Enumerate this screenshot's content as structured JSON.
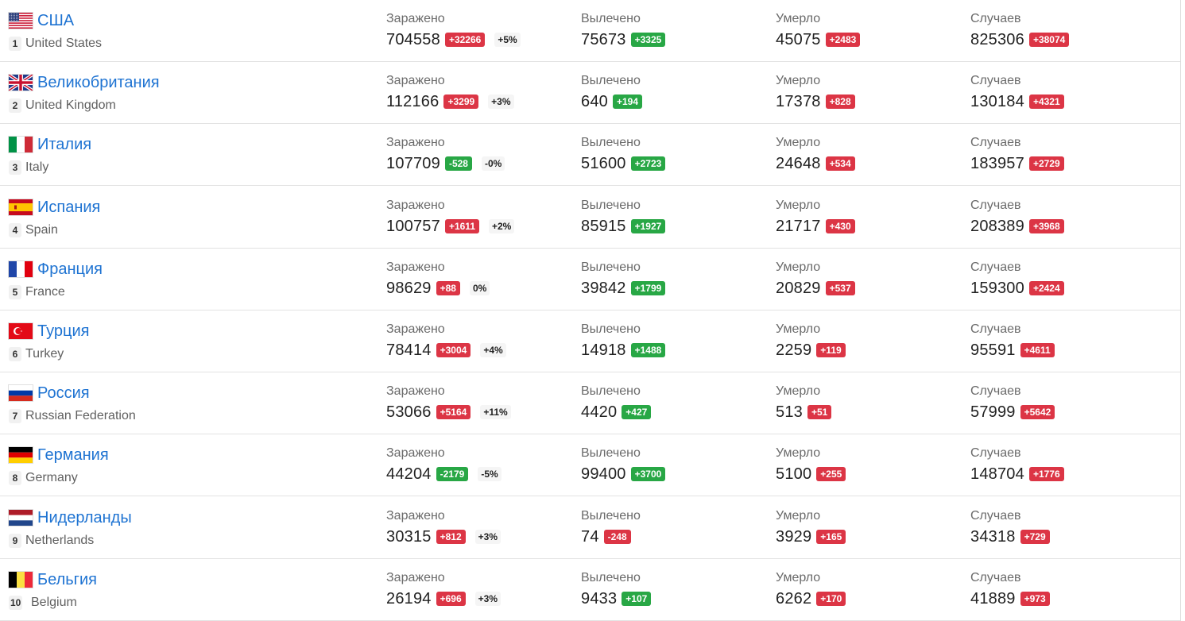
{
  "labels": {
    "infected": "Заражено",
    "recovered": "Вылечено",
    "deaths": "Умерло",
    "cases": "Случаев"
  },
  "colors": {
    "link": "#1e73d2",
    "increase": "#dc3545",
    "decrease": "#28a745"
  },
  "countries": [
    {
      "rank": "1",
      "name_ru": "США",
      "name_en": "United States",
      "flag": "us-flag-icon",
      "infected": {
        "value": "704558",
        "delta": "+32266",
        "delta_color": "red",
        "pct": "+5%"
      },
      "recovered": {
        "value": "75673",
        "delta": "+3325",
        "delta_color": "green"
      },
      "deaths": {
        "value": "45075",
        "delta": "+2483",
        "delta_color": "red"
      },
      "cases": {
        "value": "825306",
        "delta": "+38074",
        "delta_color": "red"
      }
    },
    {
      "rank": "2",
      "name_ru": "Великобритания",
      "name_en": "United Kingdom",
      "flag": "uk-flag-icon",
      "infected": {
        "value": "112166",
        "delta": "+3299",
        "delta_color": "red",
        "pct": "+3%"
      },
      "recovered": {
        "value": "640",
        "delta": "+194",
        "delta_color": "green"
      },
      "deaths": {
        "value": "17378",
        "delta": "+828",
        "delta_color": "red"
      },
      "cases": {
        "value": "130184",
        "delta": "+4321",
        "delta_color": "red"
      }
    },
    {
      "rank": "3",
      "name_ru": "Италия",
      "name_en": "Italy",
      "flag": "italy-flag-icon",
      "infected": {
        "value": "107709",
        "delta": "-528",
        "delta_color": "green",
        "pct": "-0%"
      },
      "recovered": {
        "value": "51600",
        "delta": "+2723",
        "delta_color": "green"
      },
      "deaths": {
        "value": "24648",
        "delta": "+534",
        "delta_color": "red"
      },
      "cases": {
        "value": "183957",
        "delta": "+2729",
        "delta_color": "red"
      }
    },
    {
      "rank": "4",
      "name_ru": "Испания",
      "name_en": "Spain",
      "flag": "spain-flag-icon",
      "infected": {
        "value": "100757",
        "delta": "+1611",
        "delta_color": "red",
        "pct": "+2%"
      },
      "recovered": {
        "value": "85915",
        "delta": "+1927",
        "delta_color": "green"
      },
      "deaths": {
        "value": "21717",
        "delta": "+430",
        "delta_color": "red"
      },
      "cases": {
        "value": "208389",
        "delta": "+3968",
        "delta_color": "red"
      }
    },
    {
      "rank": "5",
      "name_ru": "Франция",
      "name_en": "France",
      "flag": "france-flag-icon",
      "infected": {
        "value": "98629",
        "delta": "+88",
        "delta_color": "red",
        "pct": "0%"
      },
      "recovered": {
        "value": "39842",
        "delta": "+1799",
        "delta_color": "green"
      },
      "deaths": {
        "value": "20829",
        "delta": "+537",
        "delta_color": "red"
      },
      "cases": {
        "value": "159300",
        "delta": "+2424",
        "delta_color": "red"
      }
    },
    {
      "rank": "6",
      "name_ru": "Турция",
      "name_en": "Turkey",
      "flag": "turkey-flag-icon",
      "infected": {
        "value": "78414",
        "delta": "+3004",
        "delta_color": "red",
        "pct": "+4%"
      },
      "recovered": {
        "value": "14918",
        "delta": "+1488",
        "delta_color": "green"
      },
      "deaths": {
        "value": "2259",
        "delta": "+119",
        "delta_color": "red"
      },
      "cases": {
        "value": "95591",
        "delta": "+4611",
        "delta_color": "red"
      }
    },
    {
      "rank": "7",
      "name_ru": "Россия",
      "name_en": "Russian Federation",
      "flag": "russia-flag-icon",
      "infected": {
        "value": "53066",
        "delta": "+5164",
        "delta_color": "red",
        "pct": "+11%"
      },
      "recovered": {
        "value": "4420",
        "delta": "+427",
        "delta_color": "green"
      },
      "deaths": {
        "value": "513",
        "delta": "+51",
        "delta_color": "red"
      },
      "cases": {
        "value": "57999",
        "delta": "+5642",
        "delta_color": "red"
      }
    },
    {
      "rank": "8",
      "name_ru": "Германия",
      "name_en": "Germany",
      "flag": "germany-flag-icon",
      "infected": {
        "value": "44204",
        "delta": "-2179",
        "delta_color": "green",
        "pct": "-5%"
      },
      "recovered": {
        "value": "99400",
        "delta": "+3700",
        "delta_color": "green"
      },
      "deaths": {
        "value": "5100",
        "delta": "+255",
        "delta_color": "red"
      },
      "cases": {
        "value": "148704",
        "delta": "+1776",
        "delta_color": "red"
      }
    },
    {
      "rank": "9",
      "name_ru": "Нидерланды",
      "name_en": "Netherlands",
      "flag": "netherlands-flag-icon",
      "infected": {
        "value": "30315",
        "delta": "+812",
        "delta_color": "red",
        "pct": "+3%"
      },
      "recovered": {
        "value": "74",
        "delta": "-248",
        "delta_color": "red"
      },
      "deaths": {
        "value": "3929",
        "delta": "+165",
        "delta_color": "red"
      },
      "cases": {
        "value": "34318",
        "delta": "+729",
        "delta_color": "red"
      }
    },
    {
      "rank": "10",
      "name_ru": "Бельгия",
      "name_en": "Belgium",
      "flag": "belgium-flag-icon",
      "infected": {
        "value": "26194",
        "delta": "+696",
        "delta_color": "red",
        "pct": "+3%"
      },
      "recovered": {
        "value": "9433",
        "delta": "+107",
        "delta_color": "green"
      },
      "deaths": {
        "value": "6262",
        "delta": "+170",
        "delta_color": "red"
      },
      "cases": {
        "value": "41889",
        "delta": "+973",
        "delta_color": "red"
      }
    }
  ]
}
